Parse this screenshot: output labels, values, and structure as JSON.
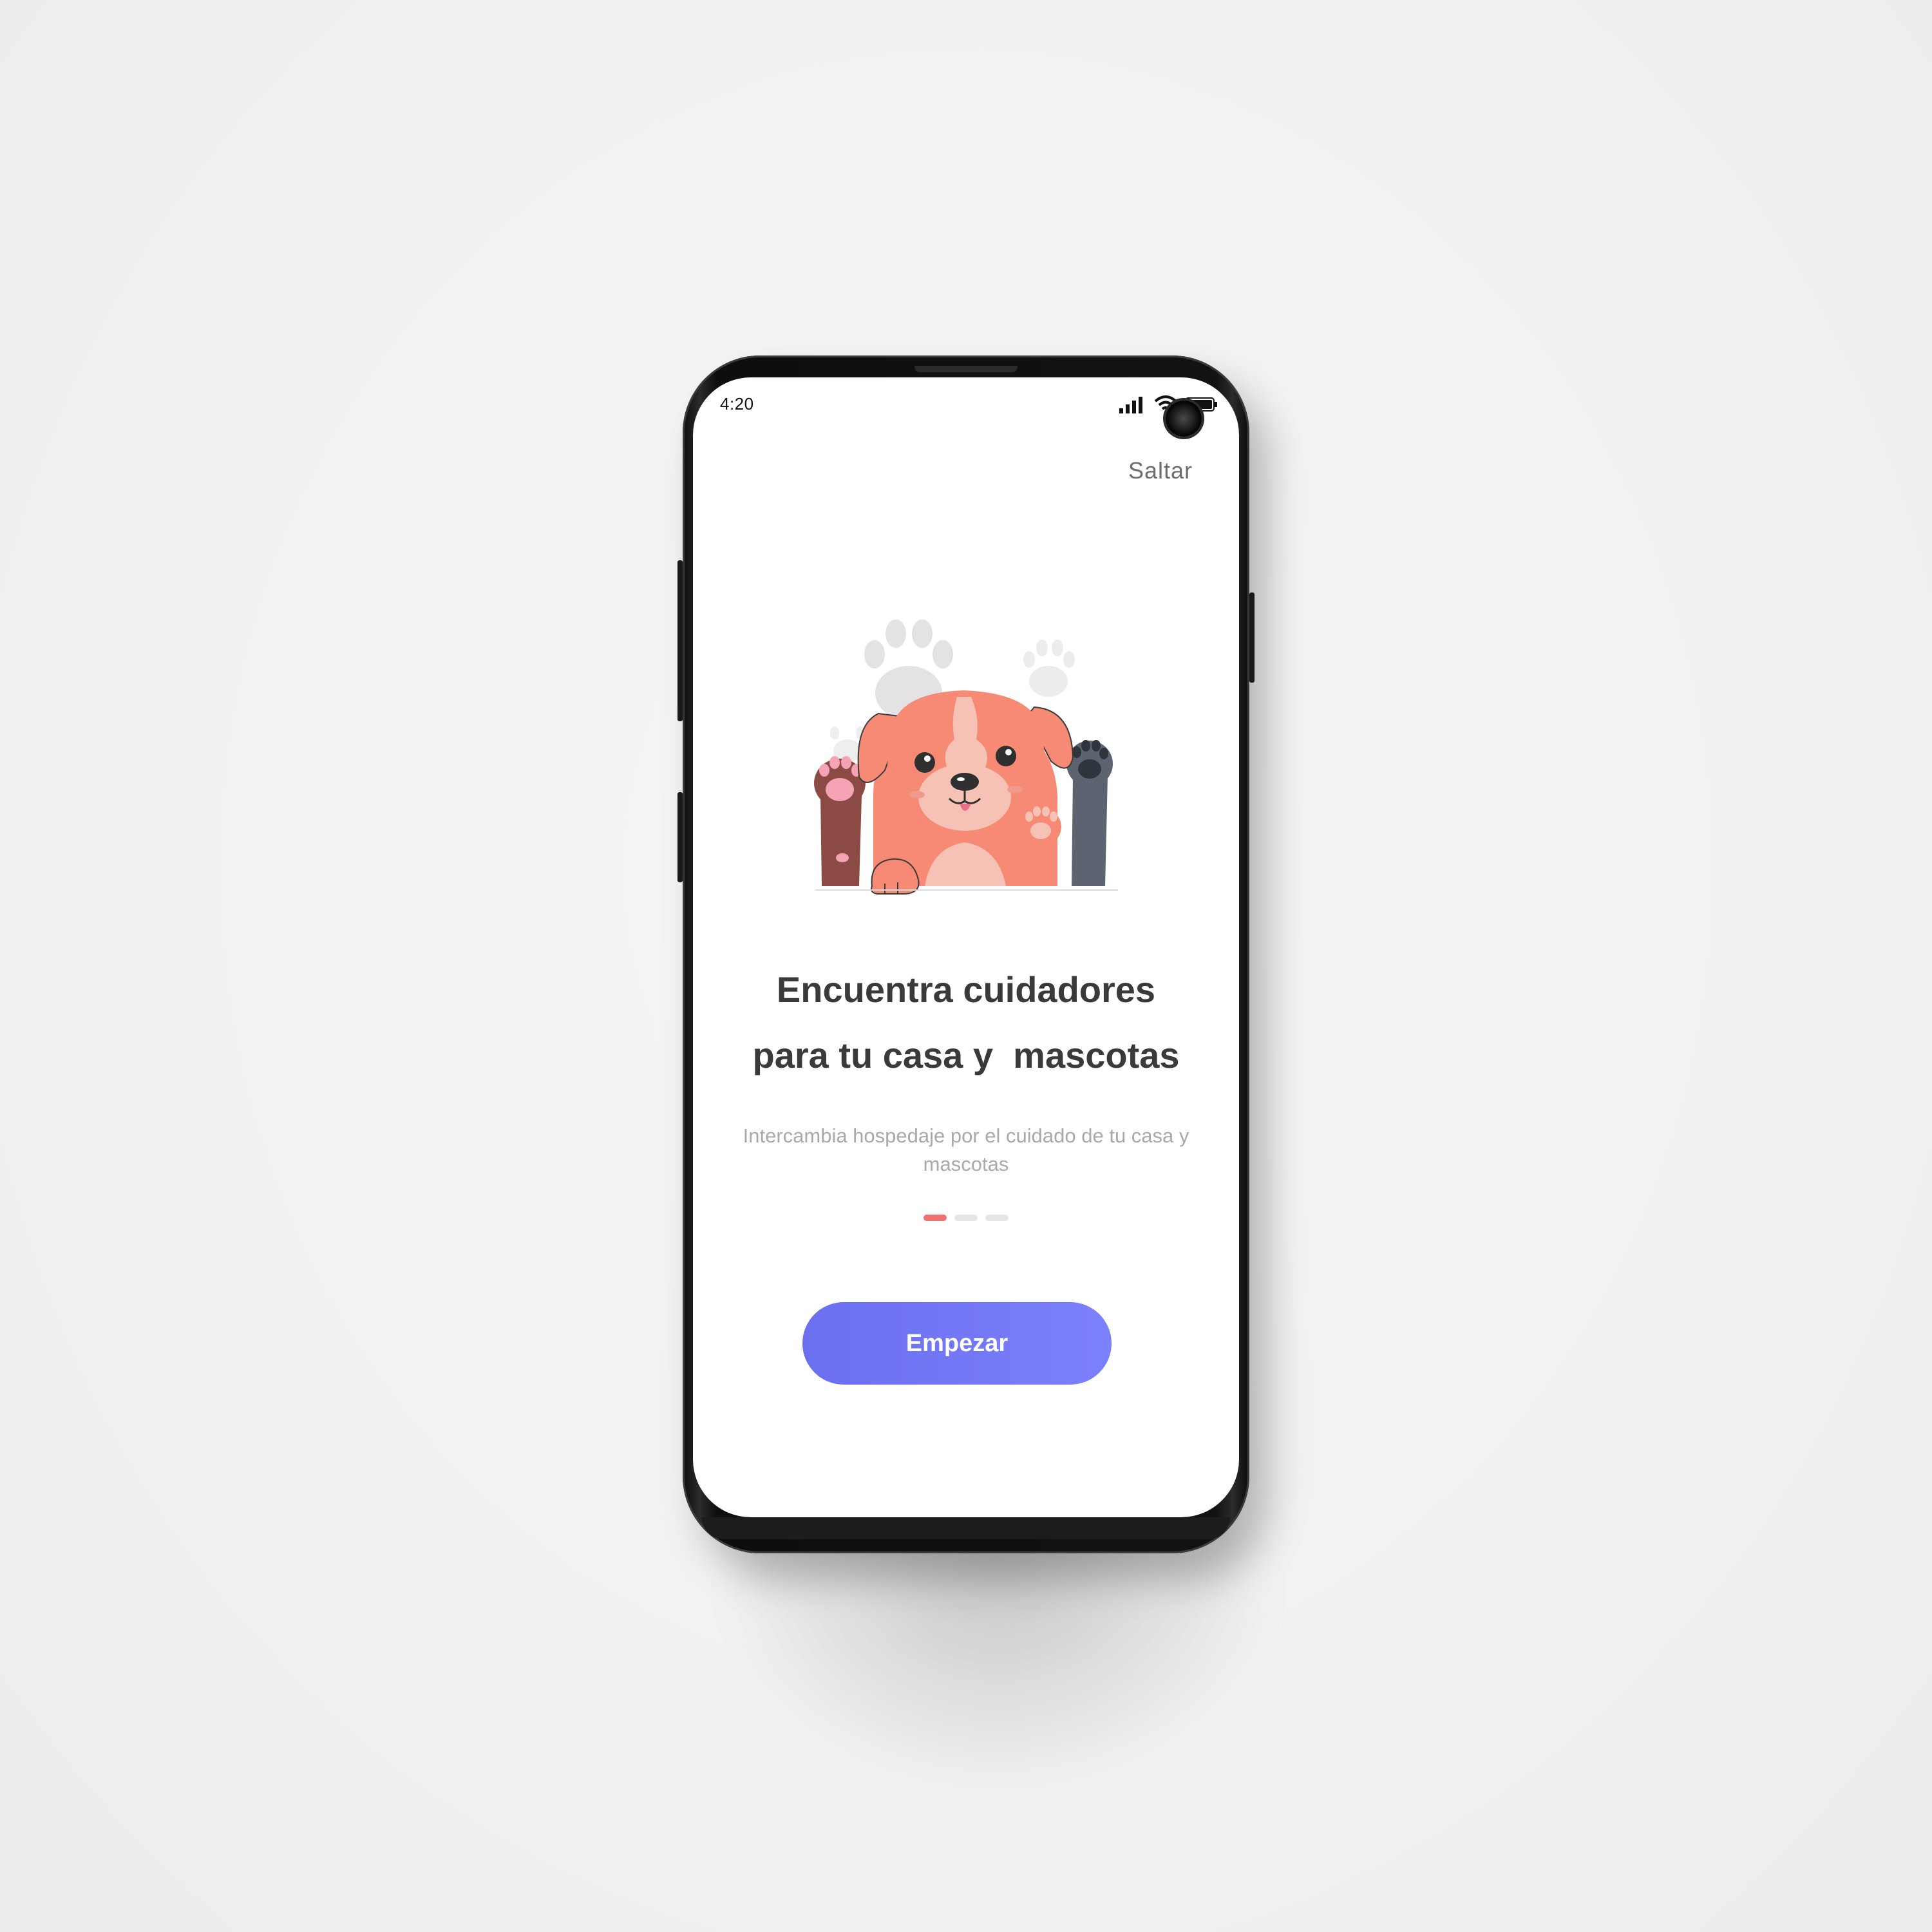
{
  "status_bar": {
    "time": "4:20",
    "icons": [
      "signal-icon",
      "wifi-icon",
      "battery-icon"
    ]
  },
  "header": {
    "skip_label": "Saltar"
  },
  "illustration": {
    "subject": "dog-illustration"
  },
  "onboarding": {
    "title_line_1": "Encuentra cuidadores",
    "title_line_2": "para tu casa y  mascotas",
    "subtitle": "Intercambia hospedaje por el cuidado de tu casa y mascotas",
    "page_count": 3,
    "active_page": 1
  },
  "cta": {
    "label": "Empezar"
  },
  "colors": {
    "accent": "#6d72f4",
    "dot_active": "#f07373",
    "dot_inactive": "#e6e6e6",
    "title": "#3a3a3a",
    "subtitle": "#a9a9a9",
    "dog_body": "#f68a75"
  }
}
